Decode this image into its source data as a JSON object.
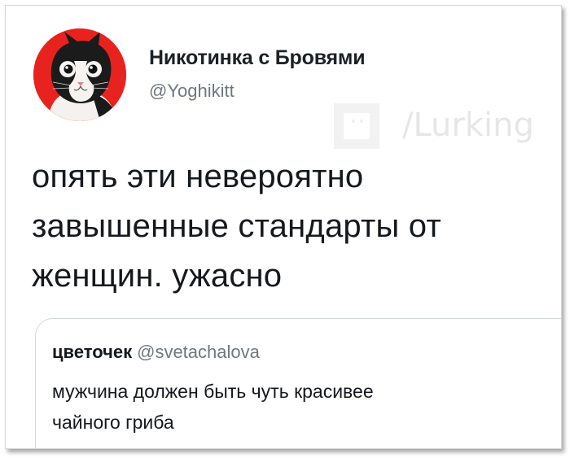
{
  "author": {
    "name": "Никотинка с Бровями",
    "handle": "@Yoghikitt",
    "avatar_icon": "cat-avatar-icon",
    "avatar_bg": "#e8231f"
  },
  "watermark": {
    "text": "/Lurking"
  },
  "tweet": {
    "lines": [
      "опять эти невероятно",
      "завышенные стандарты от",
      "женщин. ужасно"
    ]
  },
  "quoted_tweet": {
    "name": "цветочек",
    "handle": "@svetachalova",
    "lines": [
      "мужчина должен быть чуть красивее",
      "чайного гриба"
    ]
  }
}
